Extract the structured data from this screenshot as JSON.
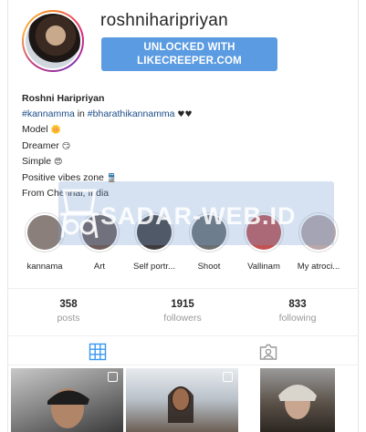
{
  "profile": {
    "username": "roshniharipriyan",
    "unlock_button": {
      "line1": "UNLOCKED WITH",
      "line2": "LIKECREEPER.COM"
    }
  },
  "bio": {
    "name": "Roshni Haripriyan",
    "line1_tag1": "#kannamma",
    "line1_mid": " in ",
    "line1_tag2": "#bharathikannamma",
    "line1_emoji": " ♥♥",
    "line2": "Model",
    "line2_emoji": " 🌼",
    "line3": "Dreamer",
    "line3_emoji": " 😏",
    "line4": "Simple",
    "line4_emoji": " 😍",
    "line5": "Positive vibes zone",
    "line5_emoji": " 🚆",
    "line6": "From Chennai, India"
  },
  "highlights": [
    {
      "label": "kannama",
      "color": "#8a7f7a"
    },
    {
      "label": "Art",
      "color": "#6e5d5a"
    },
    {
      "label": "Self portr...",
      "color": "#3f3b3c"
    },
    {
      "label": "Shoot",
      "color": "#6a6f72"
    },
    {
      "label": "Vallinam",
      "color": "#c2514f"
    },
    {
      "label": "My atroci...",
      "color": "#b9a6a8"
    }
  ],
  "watermark": {
    "text": "SADAR-WEB.ID"
  },
  "stats": {
    "posts": {
      "value": "358",
      "label": "posts"
    },
    "followers": {
      "value": "1915",
      "label": "followers"
    },
    "following": {
      "value": "833",
      "label": "following"
    }
  },
  "tabs": {
    "grid_icon": "grid-icon",
    "tagged_icon": "tagged-icon",
    "active_color": "#3897f0"
  }
}
